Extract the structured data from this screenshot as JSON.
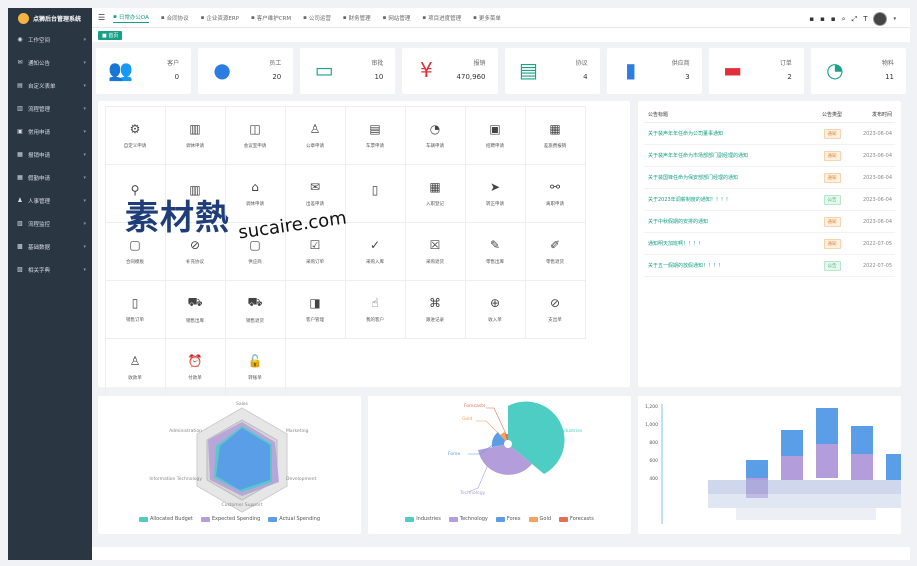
{
  "app": {
    "title": "点狮后台管理系统"
  },
  "sidebar": {
    "items": [
      {
        "label": "工作空间",
        "icon": "compass-icon"
      },
      {
        "label": "通知公告",
        "icon": "mail-icon"
      },
      {
        "label": "自定义表单",
        "icon": "form-icon"
      },
      {
        "label": "流程管理",
        "icon": "chart-icon"
      },
      {
        "label": "常用申请",
        "icon": "file-icon"
      },
      {
        "label": "报销申请",
        "icon": "wallet-icon"
      },
      {
        "label": "假勤申请",
        "icon": "calendar-icon"
      },
      {
        "label": "人事管理",
        "icon": "user-icon"
      },
      {
        "label": "流程监控",
        "icon": "monitor-icon"
      },
      {
        "label": "基础数据",
        "icon": "database-icon"
      },
      {
        "label": "相关字典",
        "icon": "book-icon"
      }
    ]
  },
  "topbar": {
    "tabs": [
      {
        "label": "日常办公OA",
        "icon": "briefcase-icon",
        "active": true
      },
      {
        "label": "合同协议",
        "icon": "contract-icon"
      },
      {
        "label": "企业资源ERP",
        "icon": "grid-icon"
      },
      {
        "label": "客户维护CRM",
        "icon": "customer-icon"
      },
      {
        "label": "公司运营",
        "icon": "gear-icon"
      },
      {
        "label": "财务管理",
        "icon": "finance-icon"
      },
      {
        "label": "网站管理",
        "icon": "globe-icon"
      },
      {
        "label": "项目进度管理",
        "icon": "project-icon"
      },
      {
        "label": "更多菜单",
        "icon": "chevron-down-icon"
      }
    ]
  },
  "breadcrumb": {
    "home": "■ 首页"
  },
  "stats": [
    {
      "label": "客户",
      "value": "0",
      "icon": "customers-icon",
      "color": "#1aa38a"
    },
    {
      "label": "员工",
      "value": "20",
      "icon": "employee-icon",
      "color": "#2b7de1"
    },
    {
      "label": "审批",
      "value": "10",
      "icon": "approval-icon",
      "color": "#1aa38a"
    },
    {
      "label": "报销",
      "value": "470,960",
      "icon": "yen-icon",
      "color": "#e0313b"
    },
    {
      "label": "协议",
      "value": "4",
      "icon": "agreement-icon",
      "color": "#1aa38a"
    },
    {
      "label": "供应商",
      "value": "3",
      "icon": "supplier-icon",
      "color": "#2b7de1"
    },
    {
      "label": "订单",
      "value": "2",
      "icon": "order-icon",
      "color": "#e0313b"
    },
    {
      "label": "物料",
      "value": "11",
      "icon": "gauge-icon",
      "color": "#1aa38a"
    }
  ],
  "apps": [
    {
      "label": "自定义申请",
      "glyph": "⚙"
    },
    {
      "label": "调休申请",
      "glyph": "▥"
    },
    {
      "label": "会议室申请",
      "glyph": "◫"
    },
    {
      "label": "公章申请",
      "glyph": "♙"
    },
    {
      "label": "车票申请",
      "glyph": "▤"
    },
    {
      "label": "车辆申请",
      "glyph": "◔"
    },
    {
      "label": "招聘申请",
      "glyph": "▣"
    },
    {
      "label": "差旅费报销",
      "glyph": "▦"
    },
    {
      "label": "",
      "glyph": "⚲"
    },
    {
      "label": "",
      "glyph": "▥"
    },
    {
      "label": "调休申请",
      "glyph": "⌂"
    },
    {
      "label": "出差申请",
      "glyph": "✉"
    },
    {
      "label": "",
      "glyph": "▯"
    },
    {
      "label": "入职登记",
      "glyph": "▦"
    },
    {
      "label": "转正申请",
      "glyph": "➤"
    },
    {
      "label": "离职申请",
      "glyph": "⚯"
    },
    {
      "label": "合同模板",
      "glyph": "▢"
    },
    {
      "label": "补充协议",
      "glyph": "⊘"
    },
    {
      "label": "供应商",
      "glyph": "▢"
    },
    {
      "label": "采购订单",
      "glyph": "☑"
    },
    {
      "label": "采购入库",
      "glyph": "✓"
    },
    {
      "label": "采购退货",
      "glyph": "☒"
    },
    {
      "label": "零售出库",
      "glyph": "✎"
    },
    {
      "label": "零售退货",
      "glyph": "✐"
    },
    {
      "label": "销售订单",
      "glyph": "▯"
    },
    {
      "label": "销售出库",
      "glyph": "⛟"
    },
    {
      "label": "销售退货",
      "glyph": "⛟"
    },
    {
      "label": "客户管理",
      "glyph": "◨"
    },
    {
      "label": "我的客户",
      "glyph": "☝"
    },
    {
      "label": "跟进记录",
      "glyph": "⌘"
    },
    {
      "label": "收入单",
      "glyph": "⊕"
    },
    {
      "label": "支出单",
      "glyph": "⊘"
    },
    {
      "label": "收款单",
      "glyph": "♙"
    },
    {
      "label": "付款单",
      "glyph": "⏰"
    },
    {
      "label": "转账单",
      "glyph": "🔓"
    }
  ],
  "notices": {
    "headers": [
      "公告标题",
      "公告类型",
      "发布时间"
    ],
    "rows": [
      {
        "title": "关于裴声年年任命为公司董事通知",
        "type": "通知",
        "date": "2023-06-04"
      },
      {
        "title": "关于裴声年年任命为市场部部门副经理的通知",
        "type": "通知",
        "date": "2023-06-04"
      },
      {
        "title": "关于裴国锋任命为保安部部门经理的通知",
        "type": "通知",
        "date": "2023-06-04"
      },
      {
        "title": "关于2023年调薪制度的通知！！！！",
        "type": "公告",
        "date": "2023-06-04"
      },
      {
        "title": "关于中秋假期的安排的通知",
        "type": "通知",
        "date": "2023-06-04"
      },
      {
        "title": "通知明天加班啊！！！！",
        "type": "通知",
        "date": "2022-07-05"
      },
      {
        "title": "关于五一假期的放假通知！！！！",
        "type": "公告",
        "date": "2022-07-05"
      }
    ]
  },
  "radar": {
    "indicators": [
      "Sales",
      "Marketing",
      "Development",
      "Customer Support",
      "Information Technology",
      "Administration"
    ],
    "legend": [
      {
        "name": "Allocated Budget",
        "color": "#4ecdc4"
      },
      {
        "name": "Expected Spending",
        "color": "#b39ddb"
      },
      {
        "name": "Actual Spending",
        "color": "#5a9ee8"
      }
    ]
  },
  "rose": {
    "labels": [
      "Industries",
      "Technology",
      "Forex",
      "Gold",
      "Forecasts"
    ],
    "legend": [
      {
        "name": "Industries",
        "color": "#4ecdc4"
      },
      {
        "name": "Technology",
        "color": "#b39ddb"
      },
      {
        "name": "Forex",
        "color": "#5a9ee8"
      },
      {
        "name": "Gold",
        "color": "#f4a261"
      },
      {
        "name": "Forecasts",
        "color": "#e76f51"
      }
    ]
  },
  "bar": {
    "yticks": [
      "400",
      "600",
      "800",
      "1,000",
      "1,200"
    ]
  },
  "watermark": {
    "cn": "素材熱",
    "en": "sucaire.com"
  }
}
